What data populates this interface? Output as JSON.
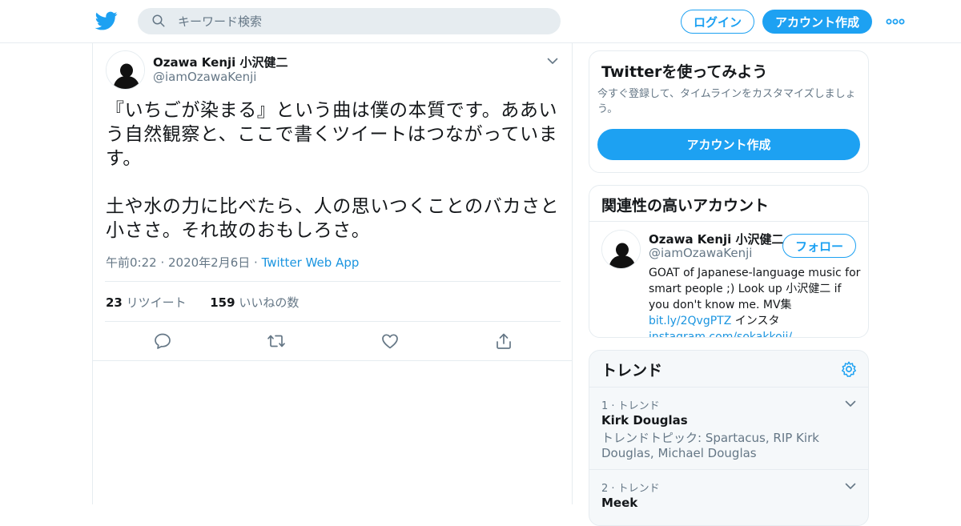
{
  "topbar": {
    "search_placeholder": "キーワード検索",
    "login_label": "ログイン",
    "signup_label": "アカウント作成",
    "logo_icon": "twitter-bird-icon",
    "more_icon": "more-dots-icon"
  },
  "tweet": {
    "name": "Ozawa Kenji 小沢健二",
    "handle": "@iamOzawaKenji",
    "text": "『いちごが染まる』という曲は僕の本質です。ああいう自然観察と、ここで書くツイートはつながっています。\n\n土や水の力に比べたら、人の思いつくことのバカさと小ささ。それ故のおもしろさ。",
    "time": "午前0:22 · 2020年2月6日 · ",
    "source": "Twitter Web App",
    "retweet_count": "23",
    "retweet_label": "リツイート",
    "like_count": "159",
    "like_label": "いいねの数"
  },
  "promo": {
    "title": "Twitterを使ってみよう",
    "desc": "今すぐ登録して、タイムラインをカスタマイズしましょう。",
    "button": "アカウント作成"
  },
  "related": {
    "title": "関連性の高いアカウント",
    "name": "Ozawa Kenji 小沢健二",
    "handle": "@iamOzawaKenji",
    "follow": "フォロー",
    "bio_text": "GOAT of Japanese-language music for smart people ;) Look up 小沢健二 if you don't know me. MV集 ",
    "bio_link1": "bit.ly/2QvgPTZ",
    "bio_text2": " インスタ ",
    "bio_link2": "instagram.com/sokakkoii/"
  },
  "trends": {
    "title": "トレンド",
    "items": [
      {
        "meta": "1 · トレンド",
        "title": "Kirk Douglas",
        "desc": "トレンドトピック: Spartacus, RIP Kirk Douglas, Michael Douglas"
      },
      {
        "meta": "2 · トレンド",
        "title": "Meek",
        "desc": ""
      }
    ]
  },
  "colors": {
    "accent": "#1da1f2",
    "link": "#1b95e0",
    "text_secondary": "#657786",
    "border": "#e6ecf0"
  }
}
